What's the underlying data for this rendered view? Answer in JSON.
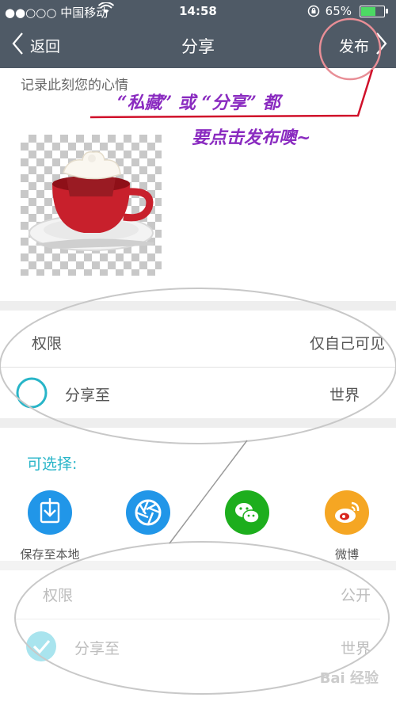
{
  "status_bar": {
    "carrier": "●●○○○ 中国移动",
    "time": "14:58",
    "battery_percent": "65%",
    "battery_level": 0.65
  },
  "nav": {
    "back_label": "返回",
    "title": "分享",
    "publish_label": "发布"
  },
  "composer": {
    "placeholder": "记录此刻您的心情"
  },
  "annotation": {
    "line1": "“私藏” 或 “分享” 都",
    "line2": "要点击发布噢~"
  },
  "settings_top": {
    "permission_label": "权限",
    "permission_value": "仅自己可见",
    "share_to_label": "分享至",
    "share_to_value": "世界"
  },
  "optional": {
    "heading": "可选择:",
    "items": [
      {
        "label": "保存至本地",
        "icon": "save-download-icon",
        "color": "#2196e8"
      },
      {
        "label": "",
        "icon": "aperture-icon",
        "color": "#2196e8"
      },
      {
        "label": "",
        "icon": "wechat-icon",
        "color": "#1dae1d"
      },
      {
        "label": "微博",
        "icon": "weibo-icon",
        "color": "#f5a623"
      }
    ]
  },
  "settings_bottom": {
    "permission_label": "权限",
    "permission_value": "公开",
    "share_to_label": "分享至",
    "share_to_value": "世界"
  },
  "watermark": {
    "text": "Bai 经验"
  },
  "colors": {
    "header_bg": "#4f5a66",
    "accent": "#28b5c8",
    "annotation_purple": "#8a2bc0",
    "annotation_red": "#d0102a"
  }
}
